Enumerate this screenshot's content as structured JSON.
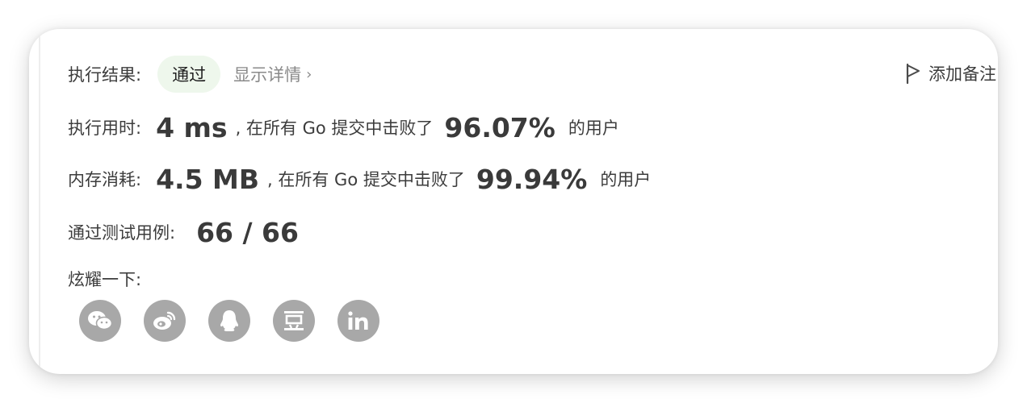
{
  "result": {
    "label": "执行结果:",
    "status": "通过",
    "details_link": "显示详情",
    "add_note": "添加备注"
  },
  "runtime": {
    "label": "执行用时:",
    "value": "4 ms",
    "prefix": ", 在所有 Go 提交中击败了",
    "percent": "96.07%",
    "suffix": "的用户"
  },
  "memory": {
    "label": "内存消耗:",
    "value": "4.5 MB",
    "prefix": ", 在所有 Go 提交中击败了",
    "percent": "99.94%",
    "suffix": "的用户"
  },
  "testcases": {
    "label": "通过测试用例:",
    "value": "66 / 66"
  },
  "share": {
    "label": "炫耀一下:",
    "icons": [
      "wechat-icon",
      "weibo-icon",
      "qq-icon",
      "douban-icon",
      "linkedin-icon"
    ],
    "icon_color": "#a8a8a8"
  },
  "colors": {
    "badge_bg": "#eef7ec",
    "text": "#3c3c3c",
    "muted": "#8a8a8a"
  }
}
